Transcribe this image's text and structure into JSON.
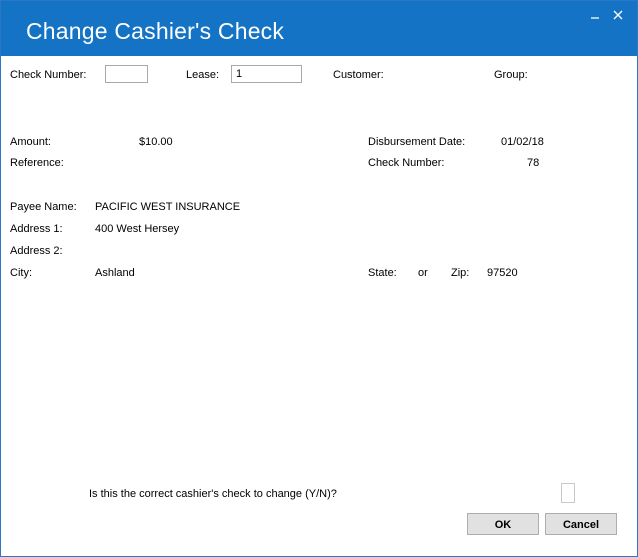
{
  "window": {
    "title": "Change Cashier's Check"
  },
  "top_fields": {
    "check_number_label": "Check Number:",
    "check_number_value": "",
    "lease_label": "Lease:",
    "lease_value": "1",
    "customer_label": "Customer:",
    "group_label": "Group:"
  },
  "details": {
    "amount_label": "Amount:",
    "amount_value": "$10.00",
    "reference_label": "Reference:",
    "disbursement_date_label": "Disbursement Date:",
    "disbursement_date_value": "01/02/18",
    "check_number_label": "Check Number:",
    "check_number_value": "78"
  },
  "payee": {
    "name_label": "Payee Name:",
    "name_value": "PACIFIC WEST INSURANCE",
    "address1_label": "Address 1:",
    "address1_value": "400 West Hersey",
    "address2_label": "Address 2:",
    "city_label": "City:",
    "city_value": "Ashland",
    "state_label": "State:",
    "state_value": "or",
    "zip_label": "Zip:",
    "zip_value": "97520"
  },
  "confirm": {
    "question": "Is this the correct cashier's check to change (Y/N)?"
  },
  "buttons": {
    "ok": "OK",
    "cancel": "Cancel"
  }
}
